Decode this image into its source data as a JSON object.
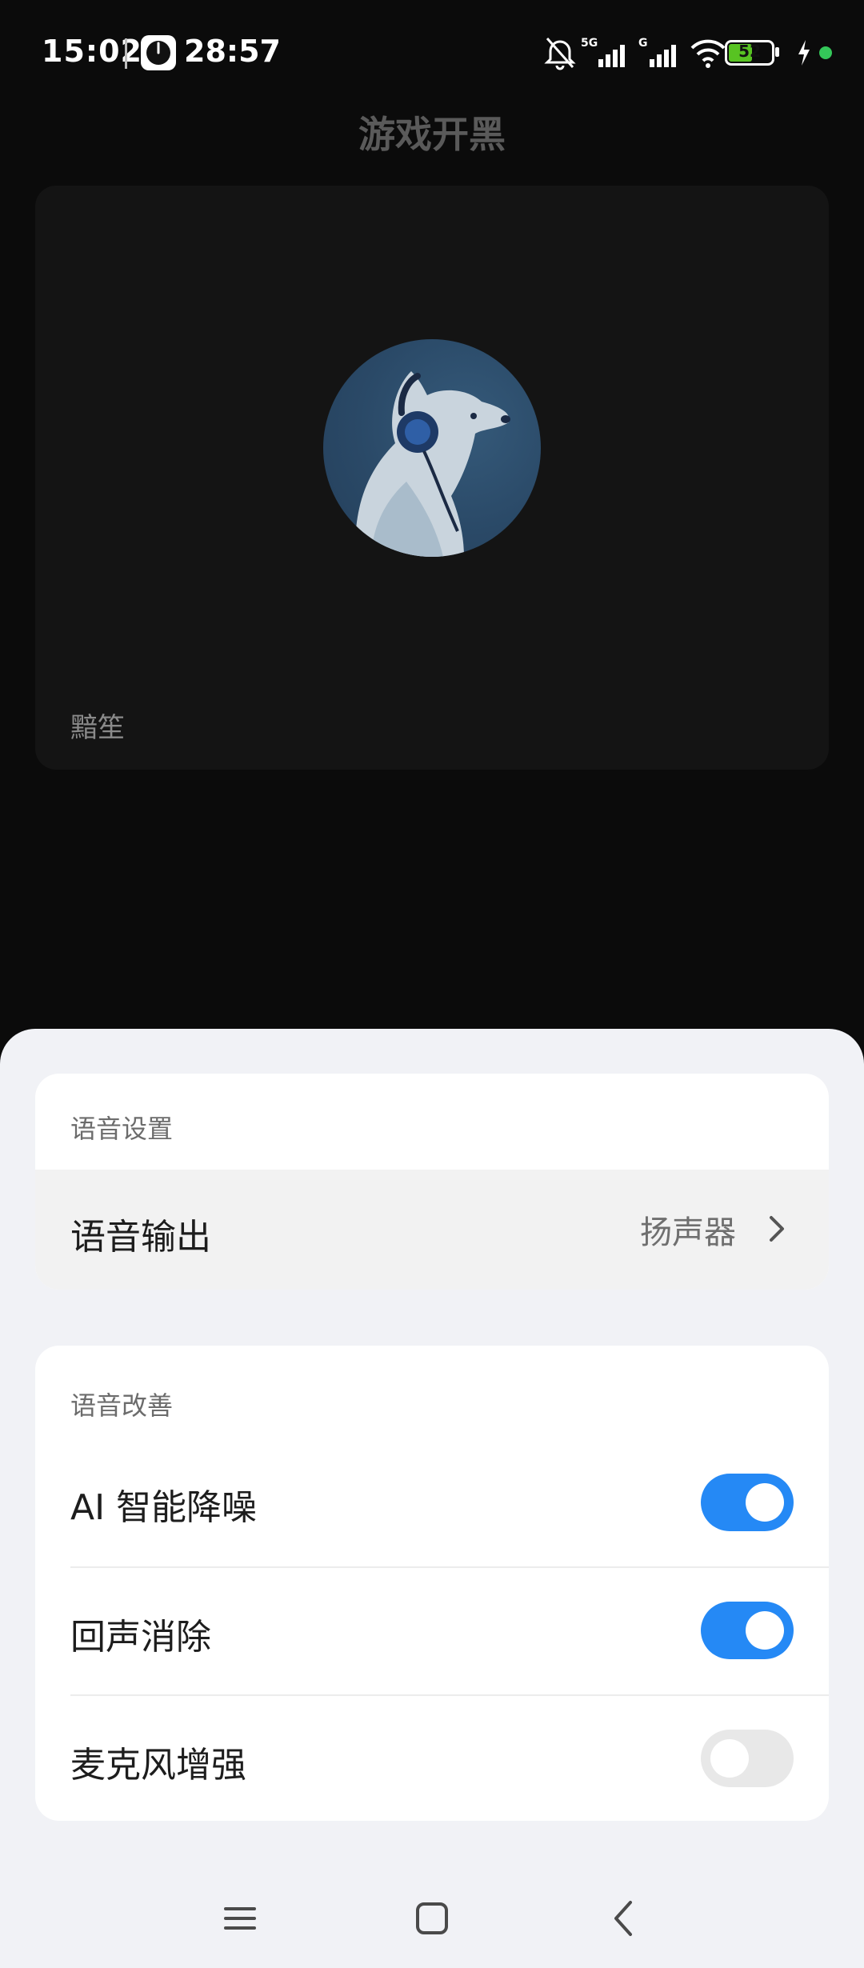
{
  "status_bar": {
    "time": "15:02",
    "timer": "28:57",
    "network_5g": "5G",
    "network_g": "G",
    "battery_level": "52",
    "battery_percent": 52
  },
  "header": {
    "title": "游戏开黑",
    "left_icon": "window-switch-icon",
    "share_icon": "send-icon",
    "settings_icon": "settings-hex-icon"
  },
  "video": {
    "user_name": "黯笙",
    "avatar": "dog-headphones-avatar"
  },
  "voice_settings": {
    "header": "语音设置",
    "output_label": "语音输出",
    "output_value": "扬声器"
  },
  "voice_improve": {
    "header": "语音改善",
    "items": [
      {
        "label": "AI 智能降噪",
        "enabled": true
      },
      {
        "label": "回声消除",
        "enabled": true
      },
      {
        "label": "麦克风增强",
        "enabled": false
      }
    ]
  },
  "colors": {
    "accent": "#2589f5",
    "toggle_off": "#e8e8e8",
    "sheet_bg": "#f1f2f6",
    "backdrop": "#0b0b0b"
  },
  "nav": {
    "menu": "menu-icon",
    "home": "home-icon",
    "back": "back-icon"
  }
}
